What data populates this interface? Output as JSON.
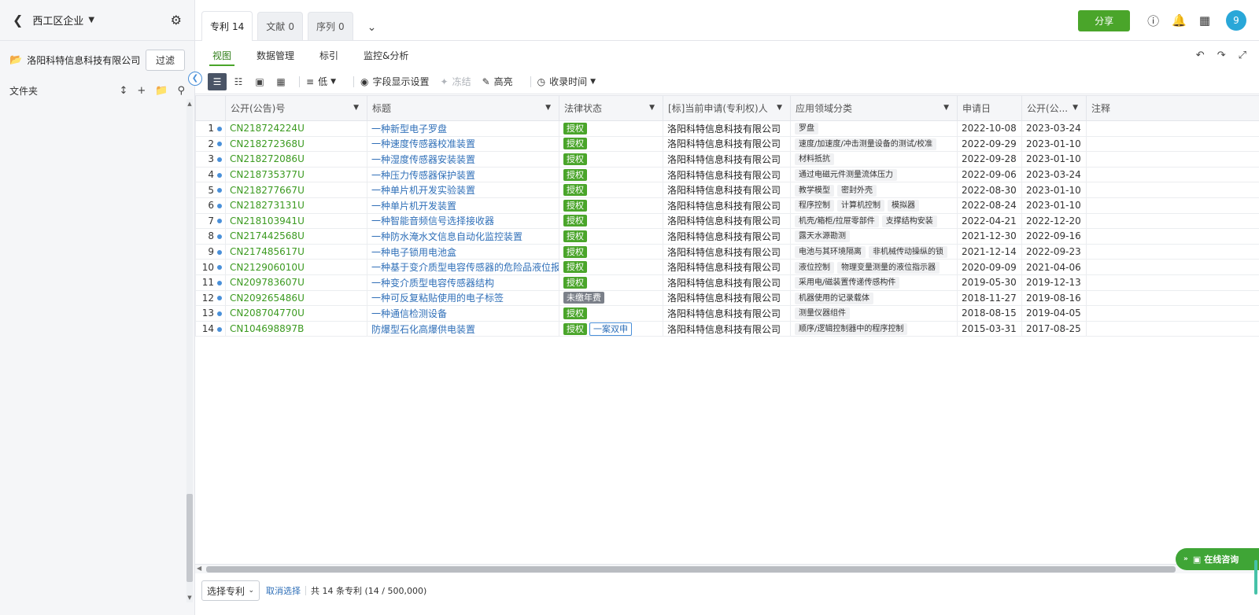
{
  "sidebar": {
    "title": "西工区企业",
    "company": "洛阳科特信息科技有限公司",
    "filter_label": "过滤",
    "folders_label": "文件夹"
  },
  "tabs": [
    {
      "label": "专利",
      "count": "14"
    },
    {
      "label": "文献",
      "count": "0"
    },
    {
      "label": "序列",
      "count": "0"
    }
  ],
  "header": {
    "share_label": "分享",
    "avatar_text": "9"
  },
  "subtabs": [
    "视图",
    "数据管理",
    "标引",
    "监控&分析"
  ],
  "toolbar": {
    "density_label": "低",
    "fields_label": "字段显示设置",
    "freeze_label": "冻结",
    "highlight_label": "高亮",
    "sort_label": "收录时间"
  },
  "columns": [
    "公开(公告)号",
    "标题",
    "法律状态",
    "[标]当前申请(专利权)人",
    "应用领域分类",
    "申请日",
    "公开(公...",
    "注释"
  ],
  "rows": [
    {
      "n": "1",
      "pn": "CN218724224U",
      "title": "一种新型电子罗盘",
      "status": [
        "授权"
      ],
      "status2": "",
      "applicant": "洛阳科特信息科技有限公司",
      "fields": [
        "罗盘"
      ],
      "app_date": "2022-10-08",
      "pub_date": "2023-03-24"
    },
    {
      "n": "2",
      "pn": "CN218272368U",
      "title": "一种速度传感器校准装置",
      "status": [
        "授权"
      ],
      "status2": "",
      "applicant": "洛阳科特信息科技有限公司",
      "fields": [
        "速度/加速度/冲击测量设备的测试/校准"
      ],
      "app_date": "2022-09-29",
      "pub_date": "2023-01-10"
    },
    {
      "n": "3",
      "pn": "CN218272086U",
      "title": "一种湿度传感器安装装置",
      "status": [
        "授权"
      ],
      "status2": "",
      "applicant": "洛阳科特信息科技有限公司",
      "fields": [
        "材料抵抗"
      ],
      "app_date": "2022-09-28",
      "pub_date": "2023-01-10"
    },
    {
      "n": "4",
      "pn": "CN218735377U",
      "title": "一种压力传感器保护装置",
      "status": [
        "授权"
      ],
      "status2": "",
      "applicant": "洛阳科特信息科技有限公司",
      "fields": [
        "通过电磁元件测量流体压力"
      ],
      "app_date": "2022-09-06",
      "pub_date": "2023-03-24"
    },
    {
      "n": "5",
      "pn": "CN218277667U",
      "title": "一种单片机开发实验装置",
      "status": [
        "授权"
      ],
      "status2": "",
      "applicant": "洛阳科特信息科技有限公司",
      "fields": [
        "教学模型",
        "密封外壳"
      ],
      "app_date": "2022-08-30",
      "pub_date": "2023-01-10"
    },
    {
      "n": "6",
      "pn": "CN218273131U",
      "title": "一种单片机开发装置",
      "status": [
        "授权"
      ],
      "status2": "",
      "applicant": "洛阳科特信息科技有限公司",
      "fields": [
        "程序控制",
        "计算机控制",
        "模拟器"
      ],
      "app_date": "2022-08-24",
      "pub_date": "2023-01-10"
    },
    {
      "n": "7",
      "pn": "CN218103941U",
      "title": "一种智能音频信号选择接收器",
      "status": [
        "授权"
      ],
      "status2": "",
      "applicant": "洛阳科特信息科技有限公司",
      "fields": [
        "机壳/箱柜/拉屉零部件",
        "支撑结构安装"
      ],
      "app_date": "2022-04-21",
      "pub_date": "2022-12-20"
    },
    {
      "n": "8",
      "pn": "CN217442568U",
      "title": "一种防水淹水文信息自动化监控装置",
      "status": [
        "授权"
      ],
      "status2": "",
      "applicant": "洛阳科特信息科技有限公司",
      "fields": [
        "露天水源勘测"
      ],
      "app_date": "2021-12-30",
      "pub_date": "2022-09-16"
    },
    {
      "n": "9",
      "pn": "CN217485617U",
      "title": "一种电子锁用电池盒",
      "status": [
        "授权"
      ],
      "status2": "",
      "applicant": "洛阳科特信息科技有限公司",
      "fields": [
        "电池与其环境隔离",
        "非机械传动操纵的锁"
      ],
      "app_date": "2021-12-14",
      "pub_date": "2022-09-23"
    },
    {
      "n": "10",
      "pn": "CN212906010U",
      "title": "一种基于变介质型电容传感器的危险品液位报",
      "status": [
        "授权"
      ],
      "status2": "",
      "applicant": "洛阳科特信息科技有限公司",
      "fields": [
        "液位控制",
        "物理变量测量的液位指示器"
      ],
      "app_date": "2020-09-09",
      "pub_date": "2021-04-06"
    },
    {
      "n": "11",
      "pn": "CN209783607U",
      "title": "一种变介质型电容传感器结构",
      "status": [
        "授权"
      ],
      "status2": "",
      "applicant": "洛阳科特信息科技有限公司",
      "fields": [
        "采用电/磁装置传递传感构件"
      ],
      "app_date": "2019-05-30",
      "pub_date": "2019-12-13"
    },
    {
      "n": "12",
      "pn": "CN209265486U",
      "title": "一种可反复粘贴使用的电子标签",
      "status": [
        "未缴年费"
      ],
      "status2": "",
      "applicant": "洛阳科特信息科技有限公司",
      "fields": [
        "机器使用的记录载体"
      ],
      "app_date": "2018-11-27",
      "pub_date": "2019-08-16"
    },
    {
      "n": "13",
      "pn": "CN208704770U",
      "title": "一种通信检测设备",
      "status": [
        "授权"
      ],
      "status2": "",
      "applicant": "洛阳科特信息科技有限公司",
      "fields": [
        "测量仪器组件"
      ],
      "app_date": "2018-08-15",
      "pub_date": "2019-04-05"
    },
    {
      "n": "14",
      "pn": "CN104698897B",
      "title": "防爆型石化高爆供电装置",
      "status": [
        "授权"
      ],
      "status2": "一案双申",
      "applicant": "洛阳科特信息科技有限公司",
      "fields": [
        "顺序/逻辑控制器中的程序控制"
      ],
      "app_date": "2015-03-31",
      "pub_date": "2017-08-25"
    }
  ],
  "footer": {
    "select_label": "选择专利",
    "cancel_label": "取消选择",
    "total_label": "共 14 条专利 (14 / 500,000)"
  },
  "online_label": "在线咨询",
  "colors": {
    "accent": "#4aa52a",
    "link": "#2f6fb8",
    "avatar": "#29a7d8"
  }
}
